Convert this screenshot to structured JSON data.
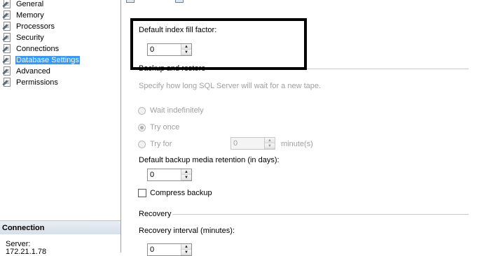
{
  "nav": {
    "items": [
      {
        "label": "General"
      },
      {
        "label": "Memory"
      },
      {
        "label": "Processors"
      },
      {
        "label": "Security"
      },
      {
        "label": "Connections"
      },
      {
        "label": "Database Settings",
        "selected": true
      },
      {
        "label": "Advanced"
      },
      {
        "label": "Permissions"
      }
    ]
  },
  "connection": {
    "header": "Connection",
    "server_label": "Server:",
    "server_value": "172.21.1.78"
  },
  "settings": {
    "fill_factor_label": "Default index fill factor:",
    "fill_factor_value": "0",
    "backup_section_title": "Backup and restore",
    "tape_description": "Specify how long SQL Server will wait for a new tape.",
    "wait_indefinitely": "Wait indefinitely",
    "try_once": "Try once",
    "try_for": "Try for",
    "try_for_value": "0",
    "minutes_unit": "minute(s)",
    "retention_label": "Default backup media retention (in days):",
    "retention_value": "0",
    "compress_backup": "Compress backup",
    "recovery_section_title": "Recovery",
    "recovery_interval_label": "Recovery interval (minutes):",
    "recovery_interval_value": "0"
  },
  "colors": {
    "selection": "#3399ff",
    "highlight_border": "#000000",
    "disabled_text": "#a0a0a0"
  }
}
